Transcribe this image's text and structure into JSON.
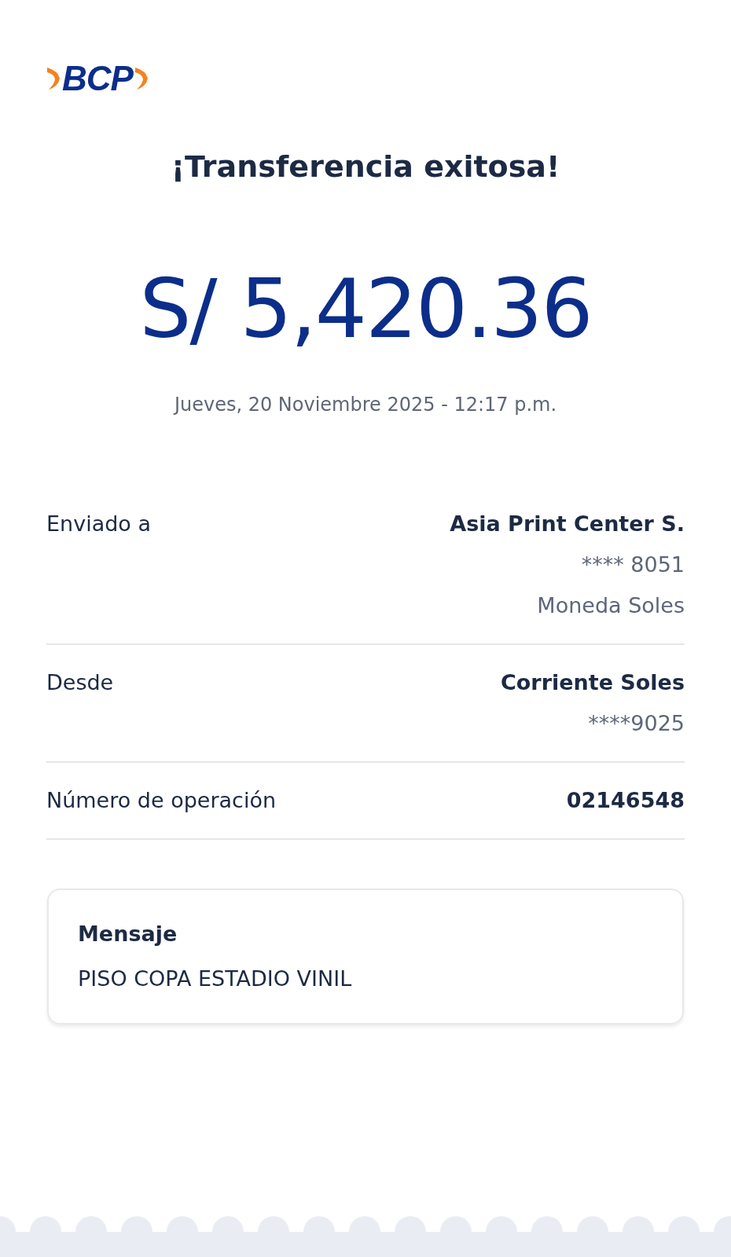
{
  "logo": {
    "text": "BCP"
  },
  "title": "¡Transferencia exitosa!",
  "amount": "S/ 5,420.36",
  "datetime": "Jueves, 20 Noviembre 2025 - 12:17 p.m.",
  "details": [
    {
      "label": "Enviado a",
      "value": "Asia Print Center S.",
      "sublines": [
        "**** 8051",
        "Moneda Soles"
      ]
    },
    {
      "label": "Desde",
      "value": "Corriente Soles",
      "sublines": [
        "****9025"
      ]
    },
    {
      "label": "Número de operación",
      "value": "02146548"
    }
  ],
  "message": {
    "title": "Mensaje",
    "text": "PISO COPA ESTADIO VINIL"
  }
}
